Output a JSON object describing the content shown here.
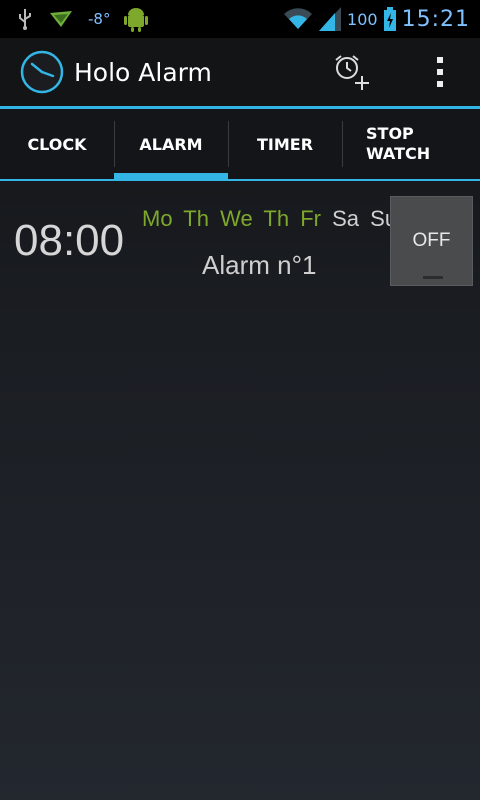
{
  "status_bar": {
    "temperature": "-8°",
    "battery": "100",
    "time": "15:21"
  },
  "action_bar": {
    "title": "Holo Alarm"
  },
  "tabs": [
    {
      "label": "CLOCK"
    },
    {
      "label": "ALARM",
      "selected": true
    },
    {
      "label": "TIMER"
    },
    {
      "label_line1": "STOP",
      "label_line2": "WATCH"
    }
  ],
  "alarms": [
    {
      "time": "08:00",
      "days": [
        {
          "label": "Mo",
          "active": true
        },
        {
          "label": "Th",
          "active": true
        },
        {
          "label": "We",
          "active": true
        },
        {
          "label": "Th",
          "active": true
        },
        {
          "label": "Fr",
          "active": true
        },
        {
          "label": "Sa",
          "active": false
        },
        {
          "label": "Su",
          "active": false
        }
      ],
      "label": "Alarm n°1",
      "toggle": "OFF"
    }
  ],
  "colors": {
    "accent": "#33b5e5",
    "active_day": "#7ea82b",
    "status_text": "#7fc1ff"
  }
}
